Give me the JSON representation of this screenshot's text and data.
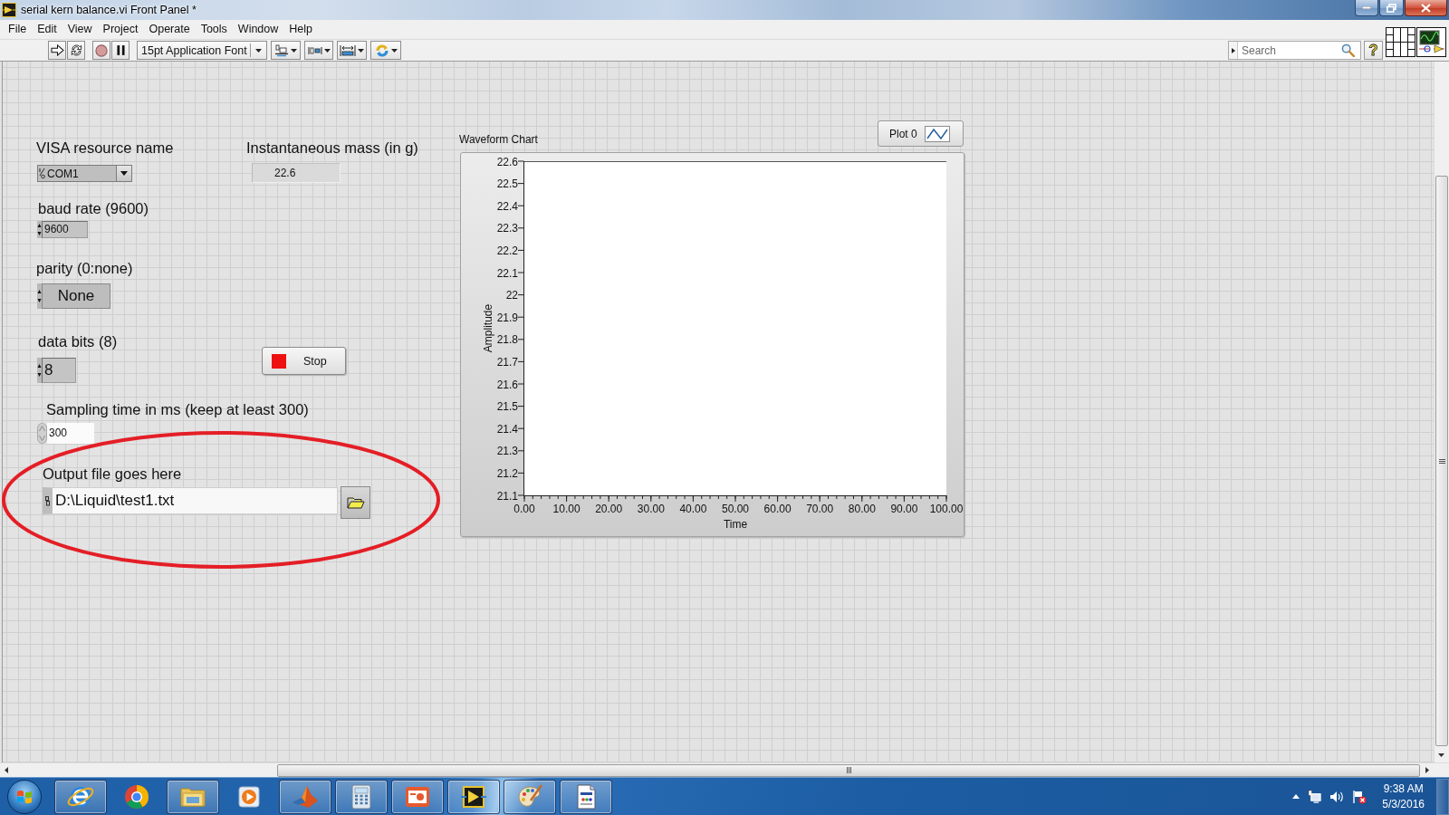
{
  "window": {
    "title": "serial kern balance.vi Front Panel *"
  },
  "menu_bar": [
    "File",
    "Edit",
    "View",
    "Project",
    "Operate",
    "Tools",
    "Window",
    "Help"
  ],
  "toolbar": {
    "font_menu": "15pt Application Font",
    "search": {
      "placeholder": "Search"
    },
    "help_button": "?"
  },
  "front_panel": {
    "visa_resource": {
      "label": "VISA resource name",
      "value": "COM1"
    },
    "instantaneous_mass": {
      "label": "Instantaneous mass (in g)",
      "value": "22.6"
    },
    "baud_rate": {
      "label": "baud rate (9600)",
      "value": "9600"
    },
    "parity": {
      "label": "parity (0:none)",
      "value": "None"
    },
    "data_bits": {
      "label": "data bits (8)",
      "value": "8"
    },
    "stop_button": {
      "label": "Stop"
    },
    "sampling_time": {
      "label": "Sampling time in ms (keep at least 300)",
      "value": "300"
    },
    "output_file": {
      "label": "Output file goes here",
      "value": "D:\\Liquid\\test1.txt"
    },
    "waveform_chart": {
      "legend": [
        {
          "name": "Plot 0"
        }
      ],
      "chart_data": {
        "type": "line",
        "title": "Waveform Chart",
        "xlabel": "Time",
        "ylabel": "Amplitude",
        "categories": [
          "0.00",
          "10.00",
          "20.00",
          "30.00",
          "40.00",
          "50.00",
          "60.00",
          "70.00",
          "80.00",
          "90.00",
          "100.00"
        ],
        "ylim": [
          21.1,
          22.6
        ],
        "yticks": [
          22.6,
          22.5,
          22.4,
          22.3,
          22.2,
          22.1,
          22,
          21.9,
          21.8,
          21.7,
          21.6,
          21.5,
          21.4,
          21.3,
          21.2,
          21.1
        ]
      }
    }
  },
  "taskbar": {
    "apps": [
      {
        "running": true
      },
      {
        "running": false
      },
      {
        "running": true
      },
      {
        "running": false
      },
      {
        "running": true
      },
      {
        "running": true
      },
      {
        "running": true
      },
      {
        "running": true
      },
      {
        "running": true
      },
      {
        "running": true
      }
    ],
    "clock": {
      "time": "9:38 AM",
      "date": "5/3/2016"
    }
  }
}
